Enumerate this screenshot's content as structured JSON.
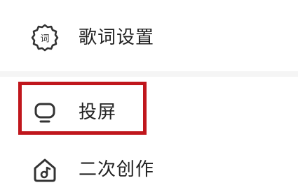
{
  "menu": {
    "items": [
      {
        "label": "歌词设置",
        "icon": "lyrics-settings-icon",
        "icon_text": "词"
      },
      {
        "label": "投屏",
        "icon": "cast-screen-icon"
      },
      {
        "label": "二次创作",
        "icon": "create-remix-icon"
      }
    ]
  },
  "colors": {
    "icon_stroke": "#333333",
    "text": "#222222",
    "divider": "#f5f5f5",
    "highlight": "#c0161c"
  }
}
